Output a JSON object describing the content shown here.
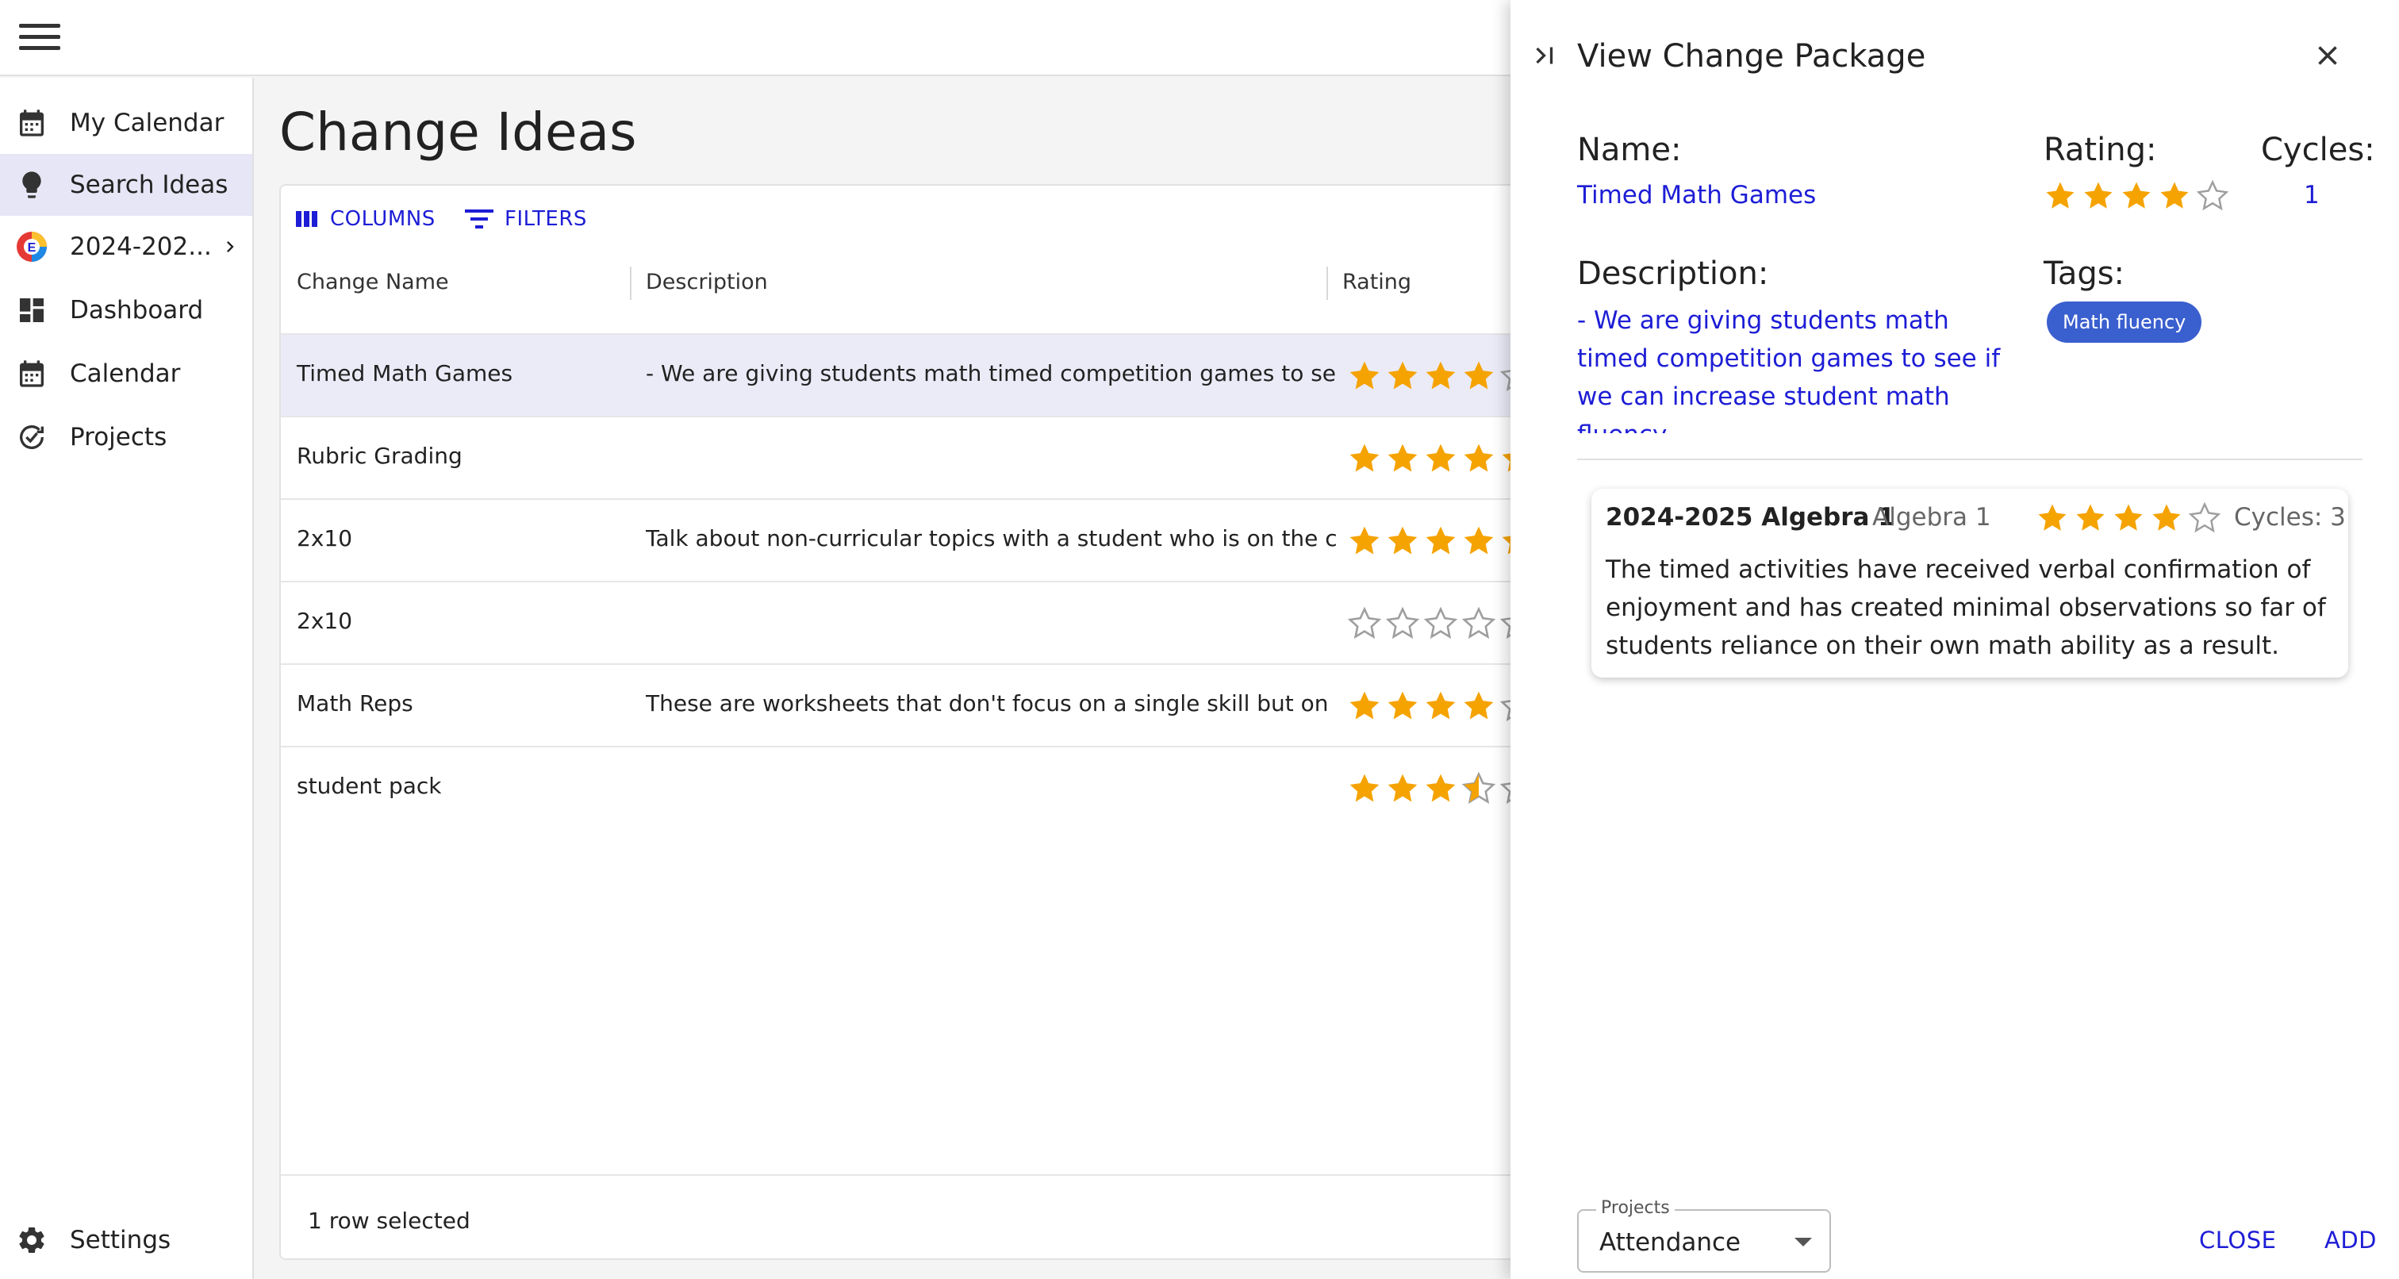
{
  "nav": {
    "items": [
      {
        "label": "My Calendar",
        "icon": "calendar-icon"
      },
      {
        "label": "Search Ideas",
        "icon": "lightbulb-icon"
      },
      {
        "label": "2024-202...",
        "icon": "org-logo-icon"
      },
      {
        "label": "Dashboard",
        "icon": "dashboard-icon"
      },
      {
        "label": "Calendar",
        "icon": "calendar-icon"
      },
      {
        "label": "Projects",
        "icon": "cycle-check-icon"
      }
    ],
    "settings_label": "Settings"
  },
  "main": {
    "title": "Change Ideas",
    "toolbar": {
      "columns_label": "COLUMNS",
      "filters_label": "FILTERS"
    },
    "columns": [
      "Change Name",
      "Description",
      "Rating"
    ],
    "rows": [
      {
        "name": "Timed Math Games",
        "description": "- We are giving students math timed competition games to see if...",
        "rating": 4
      },
      {
        "name": "Rubric Grading",
        "description": "",
        "rating": 5
      },
      {
        "name": "2x10",
        "description": "Talk about non-curricular topics with a student who is on the cus...",
        "rating": 5
      },
      {
        "name": "2x10",
        "description": "",
        "rating": 0
      },
      {
        "name": "Math Reps",
        "description": "These are worksheets that don't focus on a single skill but on ma...",
        "rating": 4
      },
      {
        "name": "student pack",
        "description": "",
        "rating": 3.5
      }
    ],
    "footer_text": "1 row selected"
  },
  "drawer": {
    "title": "View Change Package",
    "name_label": "Name:",
    "name_value": "Timed Math Games",
    "rating_label": "Rating:",
    "rating_value": 4,
    "cycles_label": "Cycles:",
    "cycles_value": "1",
    "description_label": "Description:",
    "description_value": "- We are giving students math timed competition games to see if we can increase student math fluency.\n- We also want to increase student",
    "tags_label": "Tags:",
    "tags": [
      "Math fluency"
    ],
    "project_card": {
      "title": "2024-2025 Algebra 1",
      "subtitle": "Algebra 1",
      "rating": 4,
      "cycles": "Cycles: 3",
      "body": "The timed activities have received verbal confirmation of enjoyment and has created minimal observations so far of students reliance on their own math ability as a result."
    },
    "projects_select": {
      "legend": "Projects",
      "value": "Attendance"
    },
    "close_label": "CLOSE",
    "add_label": "ADD"
  },
  "colors": {
    "accent": "#1d1dd6",
    "star": "#f5a300",
    "tag": "#3a5fcf",
    "selected_row": "#ebebf8"
  }
}
